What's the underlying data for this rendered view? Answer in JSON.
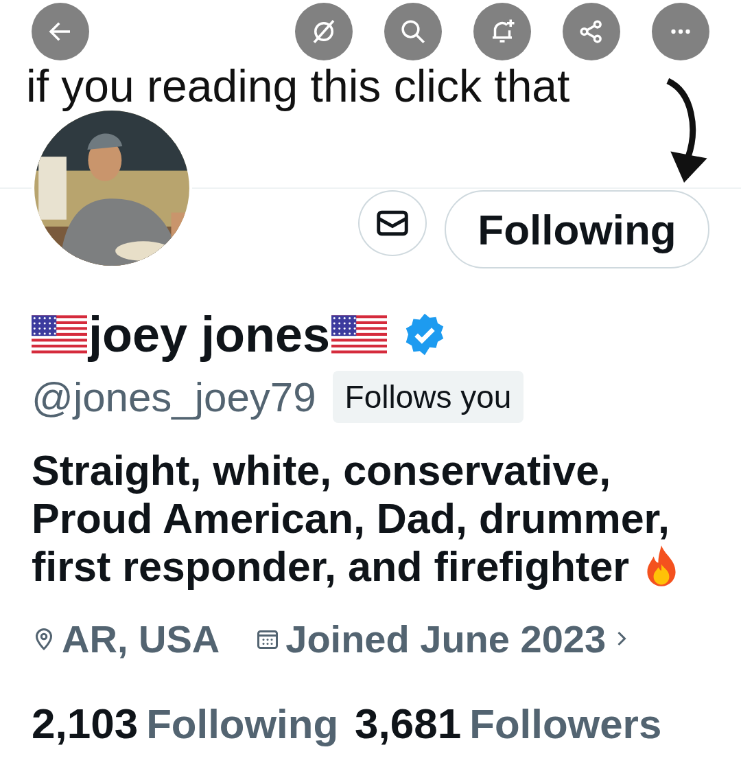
{
  "top_bar": {
    "buttons": [
      {
        "kind": "back"
      },
      {
        "kind": "grok"
      },
      {
        "kind": "search"
      },
      {
        "kind": "notify"
      },
      {
        "kind": "share"
      },
      {
        "kind": "more"
      }
    ]
  },
  "banner": {
    "text": "if you reading this click that"
  },
  "profile": {
    "name": "joey jones",
    "verified": true,
    "handle": "@jones_joey79",
    "follows_you": "Follows you",
    "follow_button": "Following",
    "bio": "Straight, white, conservative, Proud American, Dad, drummer, first responder, and firefighter",
    "location": "AR, USA",
    "joined": "Joined June 2023",
    "stats": [
      {
        "count": "2,103",
        "label": "Following"
      },
      {
        "count": "3,681",
        "label": "Followers"
      }
    ]
  }
}
